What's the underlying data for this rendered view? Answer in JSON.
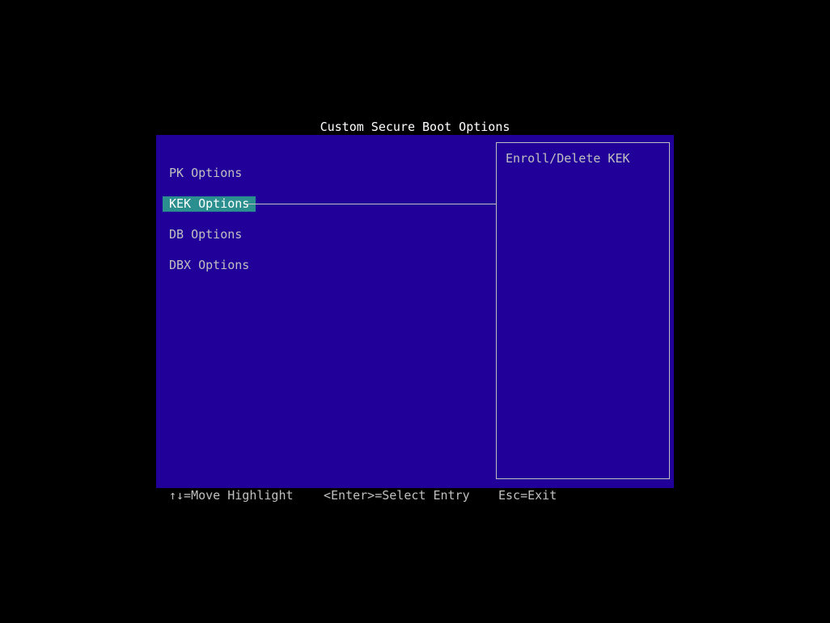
{
  "title": "Custom Secure Boot Options",
  "menu": {
    "items": [
      {
        "label": "PK Options"
      },
      {
        "label": "KEK Options"
      },
      {
        "label": "DB Options"
      },
      {
        "label": "DBX Options"
      }
    ],
    "selected_index": 1
  },
  "help": {
    "text": "Enroll/Delete KEK"
  },
  "footer": {
    "move": "↑↓=Move Highlight",
    "select": "<Enter>=Select Entry",
    "exit": "Esc=Exit"
  },
  "colors": {
    "background": "#000000",
    "panel": "#21009a",
    "highlight": "#2b8f8f",
    "text": "#c0c0c0",
    "title_text": "#ffffff"
  }
}
